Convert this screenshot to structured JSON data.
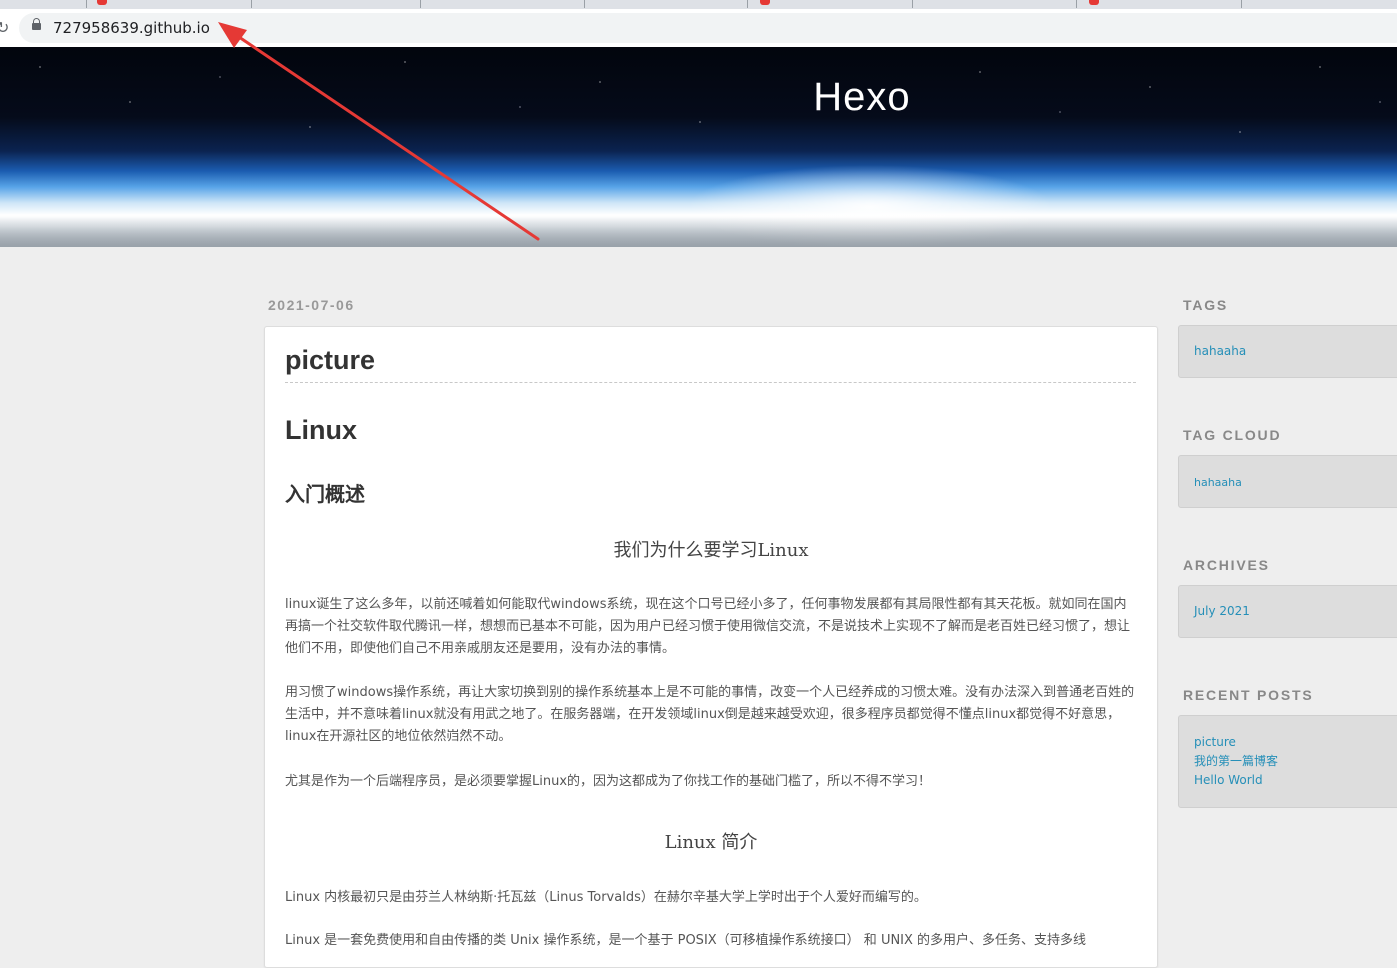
{
  "browser": {
    "url": "727958639.github.io"
  },
  "site": {
    "title": "Hexo"
  },
  "post": {
    "date": "2021-07-06",
    "title": "picture",
    "h1": "Linux",
    "h2": "入门概述",
    "section1_heading": "我们为什么要学习Linux",
    "paragraphs": [
      "linux诞生了这么多年，以前还喊着如何能取代windows系统，现在这个口号已经小多了，任何事物发展都有其局限性都有其天花板。就如同在国内再搞一个社交软件取代腾讯一样，想想而已基本不可能，因为用户已经习惯于使用微信交流，不是说技术上实现不了解而是老百姓已经习惯了，想让他们不用，即使他们自己不用亲戚朋友还是要用，没有办法的事情。",
      "用习惯了windows操作系统，再让大家切换到别的操作系统基本上是不可能的事情，改变一个人已经养成的习惯太难。没有办法深入到普通老百姓的生活中，并不意味着linux就没有用武之地了。在服务器端，在开发领域linux倒是越来越受欢迎，很多程序员都觉得不懂点linux都觉得不好意思，linux在开源社区的地位依然岿然不动。",
      "尤其是作为一个后端程序员，是必须要掌握Linux的，因为这都成为了你找工作的基础门槛了，所以不得不学习！"
    ],
    "section2_heading": "Linux 简介",
    "paragraphs2": [
      "Linux 内核最初只是由芬兰人林纳斯·托瓦兹（Linus Torvalds）在赫尔辛基大学上学时出于个人爱好而编写的。",
      "Linux 是一套免费使用和自由传播的类 Unix 操作系统，是一个基于 POSIX（可移植操作系统接口） 和 UNIX 的多用户、多任务、支持多线"
    ]
  },
  "sidebar": {
    "tags": {
      "title": "TAGS",
      "items": [
        "hahaaha"
      ]
    },
    "tag_cloud": {
      "title": "TAG CLOUD",
      "items": [
        "hahaaha"
      ]
    },
    "archives": {
      "title": "ARCHIVES",
      "items": [
        "July 2021"
      ]
    },
    "recent_posts": {
      "title": "RECENT POSTS",
      "items": [
        "picture",
        "我的第一篇博客",
        "Hello World"
      ]
    }
  },
  "colors": {
    "link": "#258fb8",
    "annotation_arrow": "#e53935"
  }
}
